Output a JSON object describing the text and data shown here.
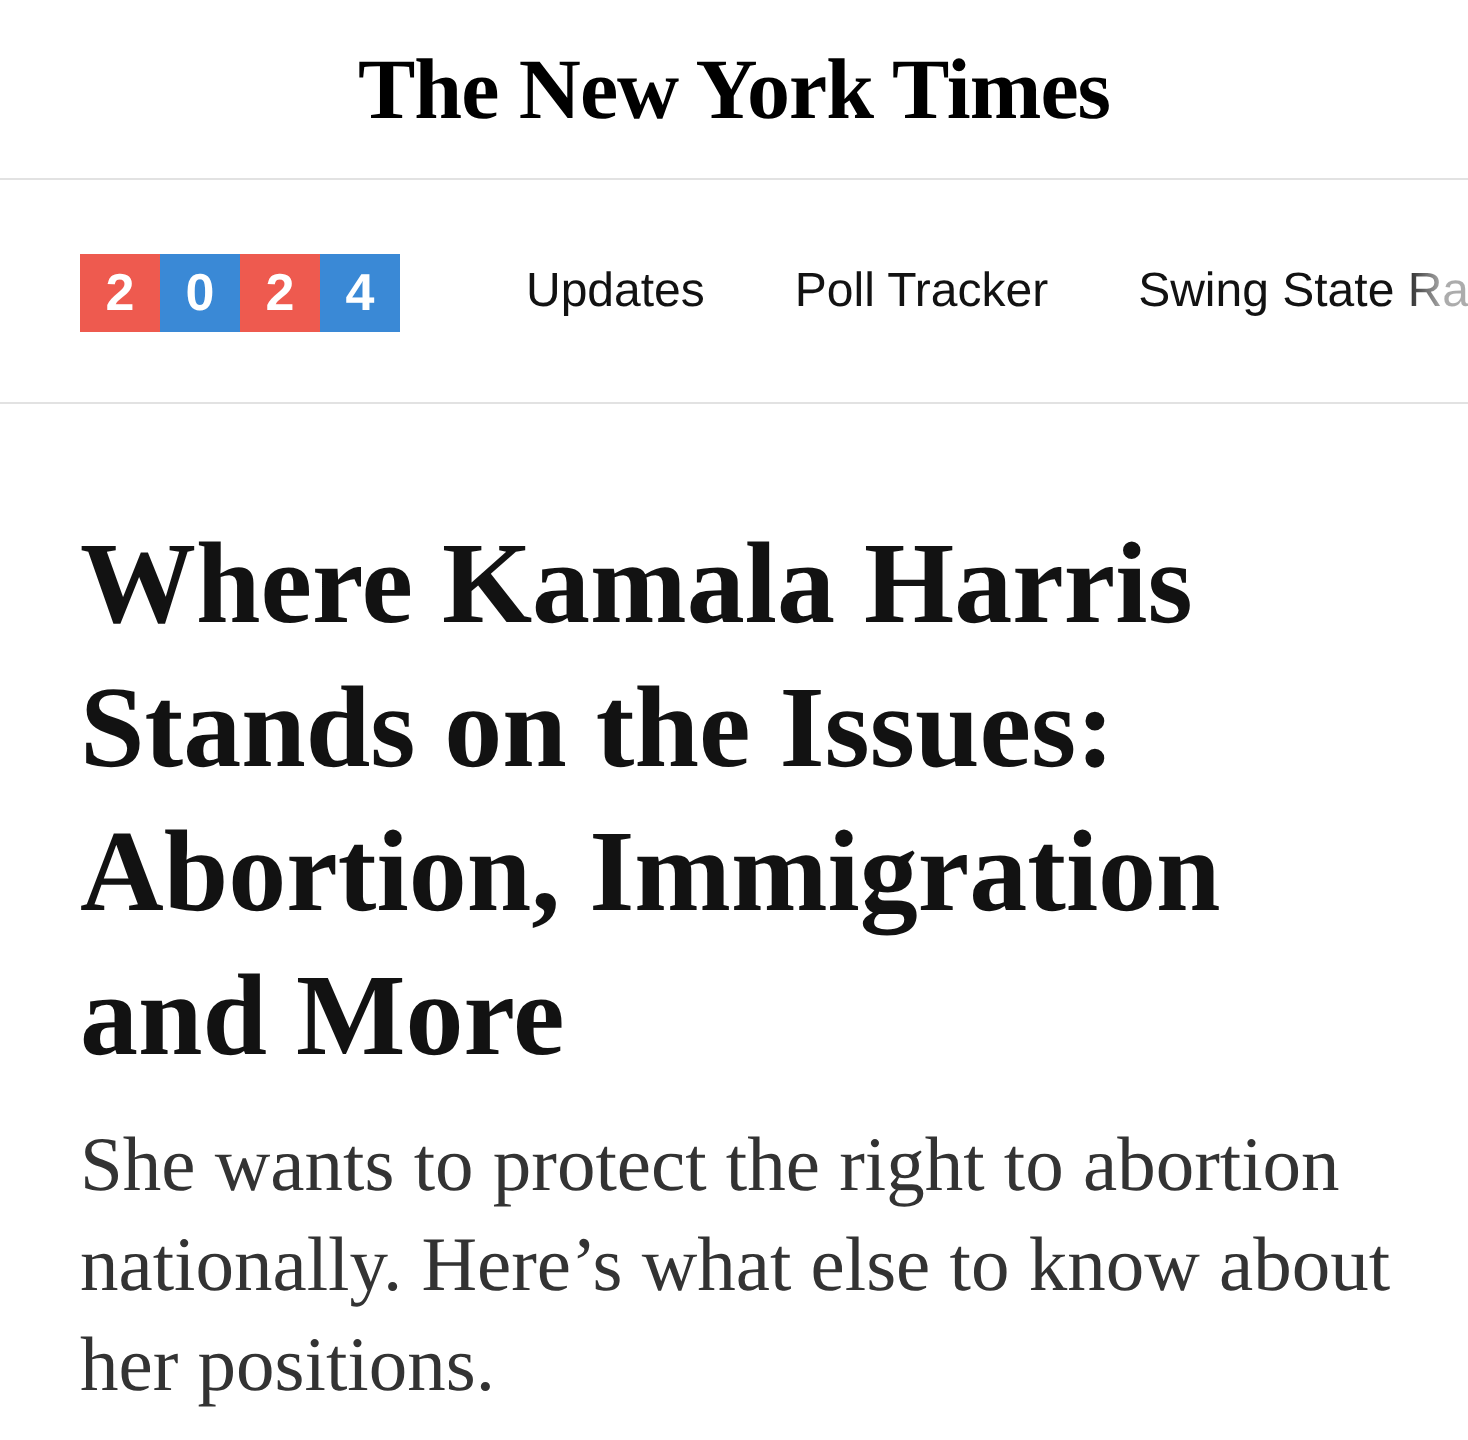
{
  "masthead": {
    "logo": "The New York Times"
  },
  "nav": {
    "badge": {
      "digits": [
        {
          "text": "2",
          "color": "#ee5a4f"
        },
        {
          "text": "0",
          "color": "#3a89d6"
        },
        {
          "text": "2",
          "color": "#ee5a4f"
        },
        {
          "text": "4",
          "color": "#3a89d6"
        }
      ]
    },
    "links": [
      {
        "label": "Updates"
      },
      {
        "label": "Poll Tracker"
      },
      {
        "label": "Swing State Ra"
      }
    ]
  },
  "article": {
    "headline": "Where Kamala Harris Stands on the Issues: Abortion, Immigration and More",
    "summary": "She wants to protect the right to abortion nationally. Here’s what else to know about her positions."
  }
}
